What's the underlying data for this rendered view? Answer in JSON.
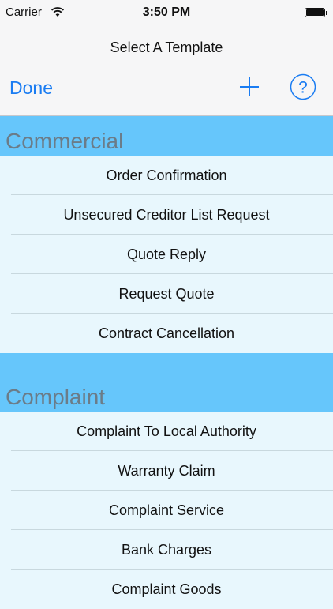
{
  "status_bar": {
    "carrier": "Carrier",
    "time": "3:50 PM"
  },
  "nav": {
    "title": "Select A Template",
    "done_label": "Done",
    "add_icon": "plus-icon",
    "help_icon": "question-mark-circle-icon"
  },
  "colors": {
    "accent": "#1a7cf2",
    "section_header_bg": "#66c6fb",
    "row_bg": "#e8f7fd"
  },
  "sections": [
    {
      "title": "Commercial",
      "items": [
        "Order Confirmation",
        "Unsecured Creditor List Request",
        "Quote Reply",
        "Request Quote",
        "Contract Cancellation"
      ]
    },
    {
      "title": "Complaint",
      "items": [
        "Complaint To Local Authority",
        "Warranty Claim",
        "Complaint Service",
        "Bank Charges",
        "Complaint Goods"
      ]
    }
  ]
}
